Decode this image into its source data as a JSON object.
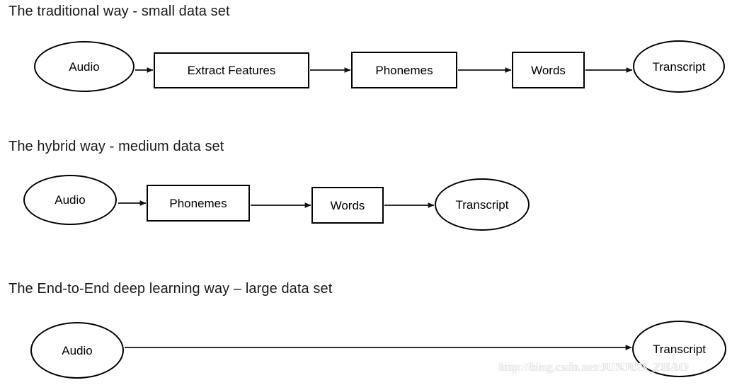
{
  "diagram": {
    "title_row_1": "The traditional way - small data set",
    "title_row_2": "The hybrid way - medium data set",
    "title_row_3": "The End-to-End deep learning way – large data set",
    "rows": [
      {
        "id": "traditional",
        "title": "The traditional way - small data set",
        "nodes": [
          {
            "label": "Audio",
            "shape": "ellipse"
          },
          {
            "label": "Extract Features",
            "shape": "box"
          },
          {
            "label": "Phonemes",
            "shape": "box"
          },
          {
            "label": "Words",
            "shape": "box"
          },
          {
            "label": "Transcript",
            "shape": "ellipse"
          }
        ]
      },
      {
        "id": "hybrid",
        "title": "The hybrid way - medium data set",
        "nodes": [
          {
            "label": "Audio",
            "shape": "ellipse"
          },
          {
            "label": "Phonemes",
            "shape": "box"
          },
          {
            "label": "Words",
            "shape": "box"
          },
          {
            "label": "Transcript",
            "shape": "ellipse"
          }
        ]
      },
      {
        "id": "end-to-end",
        "title": "The End-to-End deep learning way – large data set",
        "nodes": [
          {
            "label": "Audio",
            "shape": "ellipse"
          },
          {
            "label": "Transcript",
            "shape": "ellipse"
          }
        ]
      }
    ]
  },
  "watermark": {
    "text": "http://blog.csdn.net/JUNJUN_ZHAO"
  },
  "colors": {
    "background": "#ffffff",
    "stroke": "#000000",
    "title_text": "#1a1a1a",
    "node_text": "#000000",
    "watermark_text": "#e4e4e4"
  }
}
